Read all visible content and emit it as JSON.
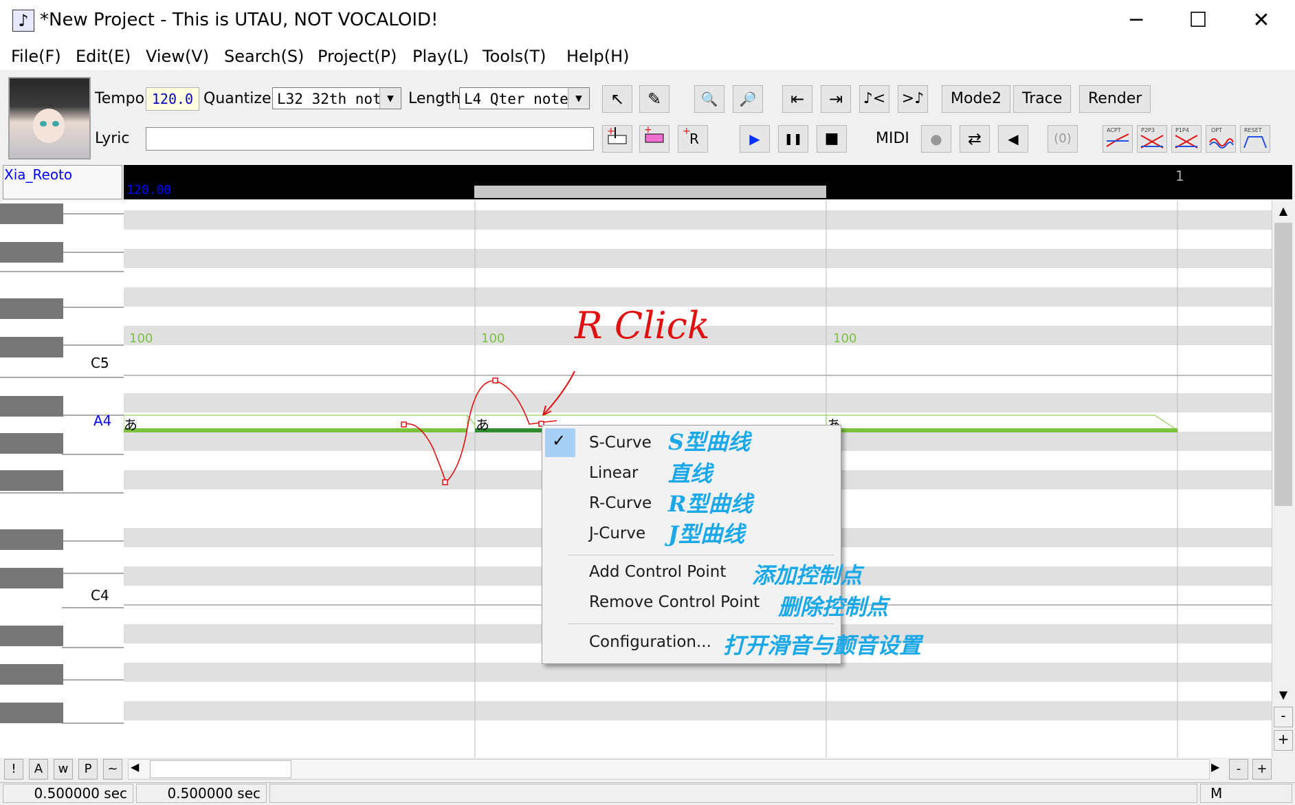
{
  "window": {
    "title": "*New Project - This is UTAU, NOT VOCALOID!",
    "app_icon_glyph": "♪",
    "minimize_glyph": "─",
    "maximize_glyph": "☐",
    "close_glyph": "✕"
  },
  "menu": {
    "items": [
      "File(F)",
      "Edit(E)",
      "View(V)",
      "Search(S)",
      "Project(P)",
      "Play(L)",
      "Tools(T)",
      "Help(H)"
    ]
  },
  "toolbar": {
    "tempo_label": "Tempo",
    "tempo_value": "120.0",
    "quantize_label": "Quantize",
    "quantize_value": "L32 32th note",
    "length_label": "Length",
    "length_value": "L4  Qter note",
    "lyric_label": "Lyric",
    "lyric_value": "",
    "mode2_label": "Mode2",
    "trace_label": "Trace",
    "render_label": "Render",
    "midi_label": "MIDI",
    "dropdown_glyph": "▼",
    "icon_glyphs": {
      "arrow": "↖",
      "pencil": "✎",
      "zoom_in": "🔍",
      "zoom_out": "🔎",
      "to_start": "⇤",
      "to_end": "⇥",
      "play": "▶",
      "pause": "❚❚",
      "stop": "■",
      "record": "●",
      "loop": "⇄",
      "speaker": "◀"
    }
  },
  "editor": {
    "singer": "Xia_Reoto",
    "tempo_marker": "120.00",
    "measure_number": "1",
    "pitch_labels": {
      "c5": "C5",
      "a4": "A4",
      "c4": "C4"
    },
    "notes": [
      {
        "lyric": "あ",
        "velocity": "100"
      },
      {
        "lyric": "あ",
        "velocity": "100"
      },
      {
        "lyric": "あ",
        "velocity": "100"
      }
    ],
    "annotation_rclick": "R Click"
  },
  "context_menu": {
    "items": [
      {
        "label": "S-Curve",
        "annotation": "S型曲线",
        "checked": true
      },
      {
        "label": "Linear",
        "annotation": "直线"
      },
      {
        "label": "R-Curve",
        "annotation": "R型曲线"
      },
      {
        "label": "J-Curve",
        "annotation": "J型曲线"
      },
      {
        "label": "Add Control Point",
        "annotation": "添加控制点"
      },
      {
        "label": "Remove Control Point",
        "annotation": "删除控制点"
      },
      {
        "label": "Configuration...",
        "annotation": "打开滑音与颤音设置"
      }
    ],
    "check_glyph": "✓"
  },
  "bottom": {
    "mode_buttons": [
      "!",
      "A",
      "w",
      "P",
      "~"
    ],
    "left_arrow": "◀",
    "right_arrow": "▶",
    "zoom_minus": "-",
    "zoom_plus": "+"
  },
  "status": {
    "cell1": "0.500000 sec",
    "cell2": "0.500000 sec",
    "mode": "M"
  },
  "colors": {
    "note_line": "#7cc23c",
    "pitch_curve": "#e01010",
    "annotation_blue": "#1aa8e8"
  }
}
